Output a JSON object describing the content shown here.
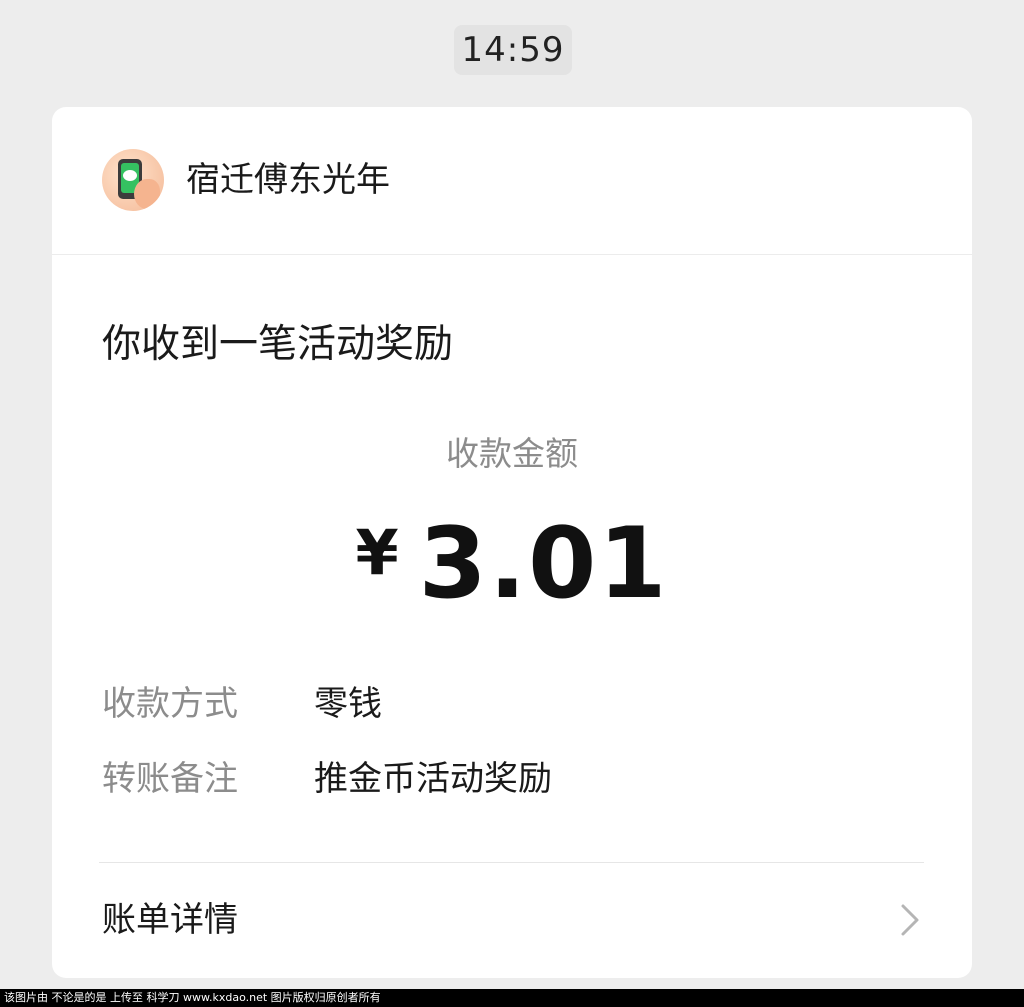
{
  "timestamp": "14:59",
  "merchant": {
    "name": "宿迁傅东光年",
    "avatar_icon": "wechat-pay-phone-icon"
  },
  "message": {
    "title": "你收到一笔活动奖励"
  },
  "amount": {
    "label": "收款金额",
    "currency_symbol": "¥",
    "value": "3.01"
  },
  "details": [
    {
      "key": "收款方式",
      "value": "零钱"
    },
    {
      "key": "转账备注",
      "value": "推金币活动奖励"
    }
  ],
  "bill_link": {
    "label": "账单详情",
    "icon": "chevron-right-icon"
  },
  "footer_notice": "该图片由 不论是的是 上传至 科学刀 www.kxdao.net 图片版权归原创者所有",
  "colors": {
    "background": "#ededed",
    "card": "#ffffff",
    "muted_text": "#8c8c8c",
    "primary_text": "#1a1a1a"
  }
}
